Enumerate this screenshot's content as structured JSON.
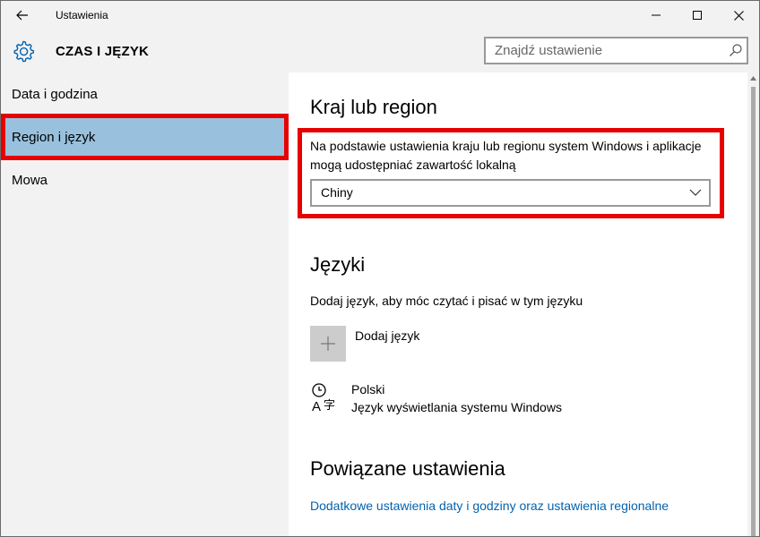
{
  "window": {
    "title": "Ustawienia"
  },
  "header": {
    "title": "CZAS I JĘZYK",
    "search_placeholder": "Znajdź ustawienie"
  },
  "sidebar": {
    "items": [
      {
        "label": "Data i godzina",
        "selected": false
      },
      {
        "label": "Region i język",
        "selected": true
      },
      {
        "label": "Mowa",
        "selected": false
      }
    ]
  },
  "main": {
    "region": {
      "heading": "Kraj lub region",
      "description": "Na podstawie ustawienia kraju lub regionu system Windows i aplikacje mogą udostępniać zawartość lokalną",
      "selected_value": "Chiny"
    },
    "languages": {
      "heading": "Języki",
      "description": "Dodaj język, aby móc czytać i pisać w tym języku",
      "add_label": "Dodaj język",
      "items": [
        {
          "name": "Polski",
          "subtitle": "Język wyświetlania systemu Windows"
        }
      ]
    },
    "related": {
      "heading": "Powiązane ustawienia",
      "link": "Dodatkowe ustawienia daty i godziny oraz ustawienia regionalne"
    }
  },
  "colors": {
    "accent_link": "#0063b1",
    "selected_item": "#99c1de",
    "highlight_box": "#e60000",
    "chrome_bg": "#f2f2f2"
  },
  "icons": [
    "back-arrow-icon",
    "minimize-icon",
    "maximize-icon",
    "close-icon",
    "gear-icon",
    "search-icon",
    "chevron-down-icon",
    "plus-icon",
    "language-icon"
  ]
}
